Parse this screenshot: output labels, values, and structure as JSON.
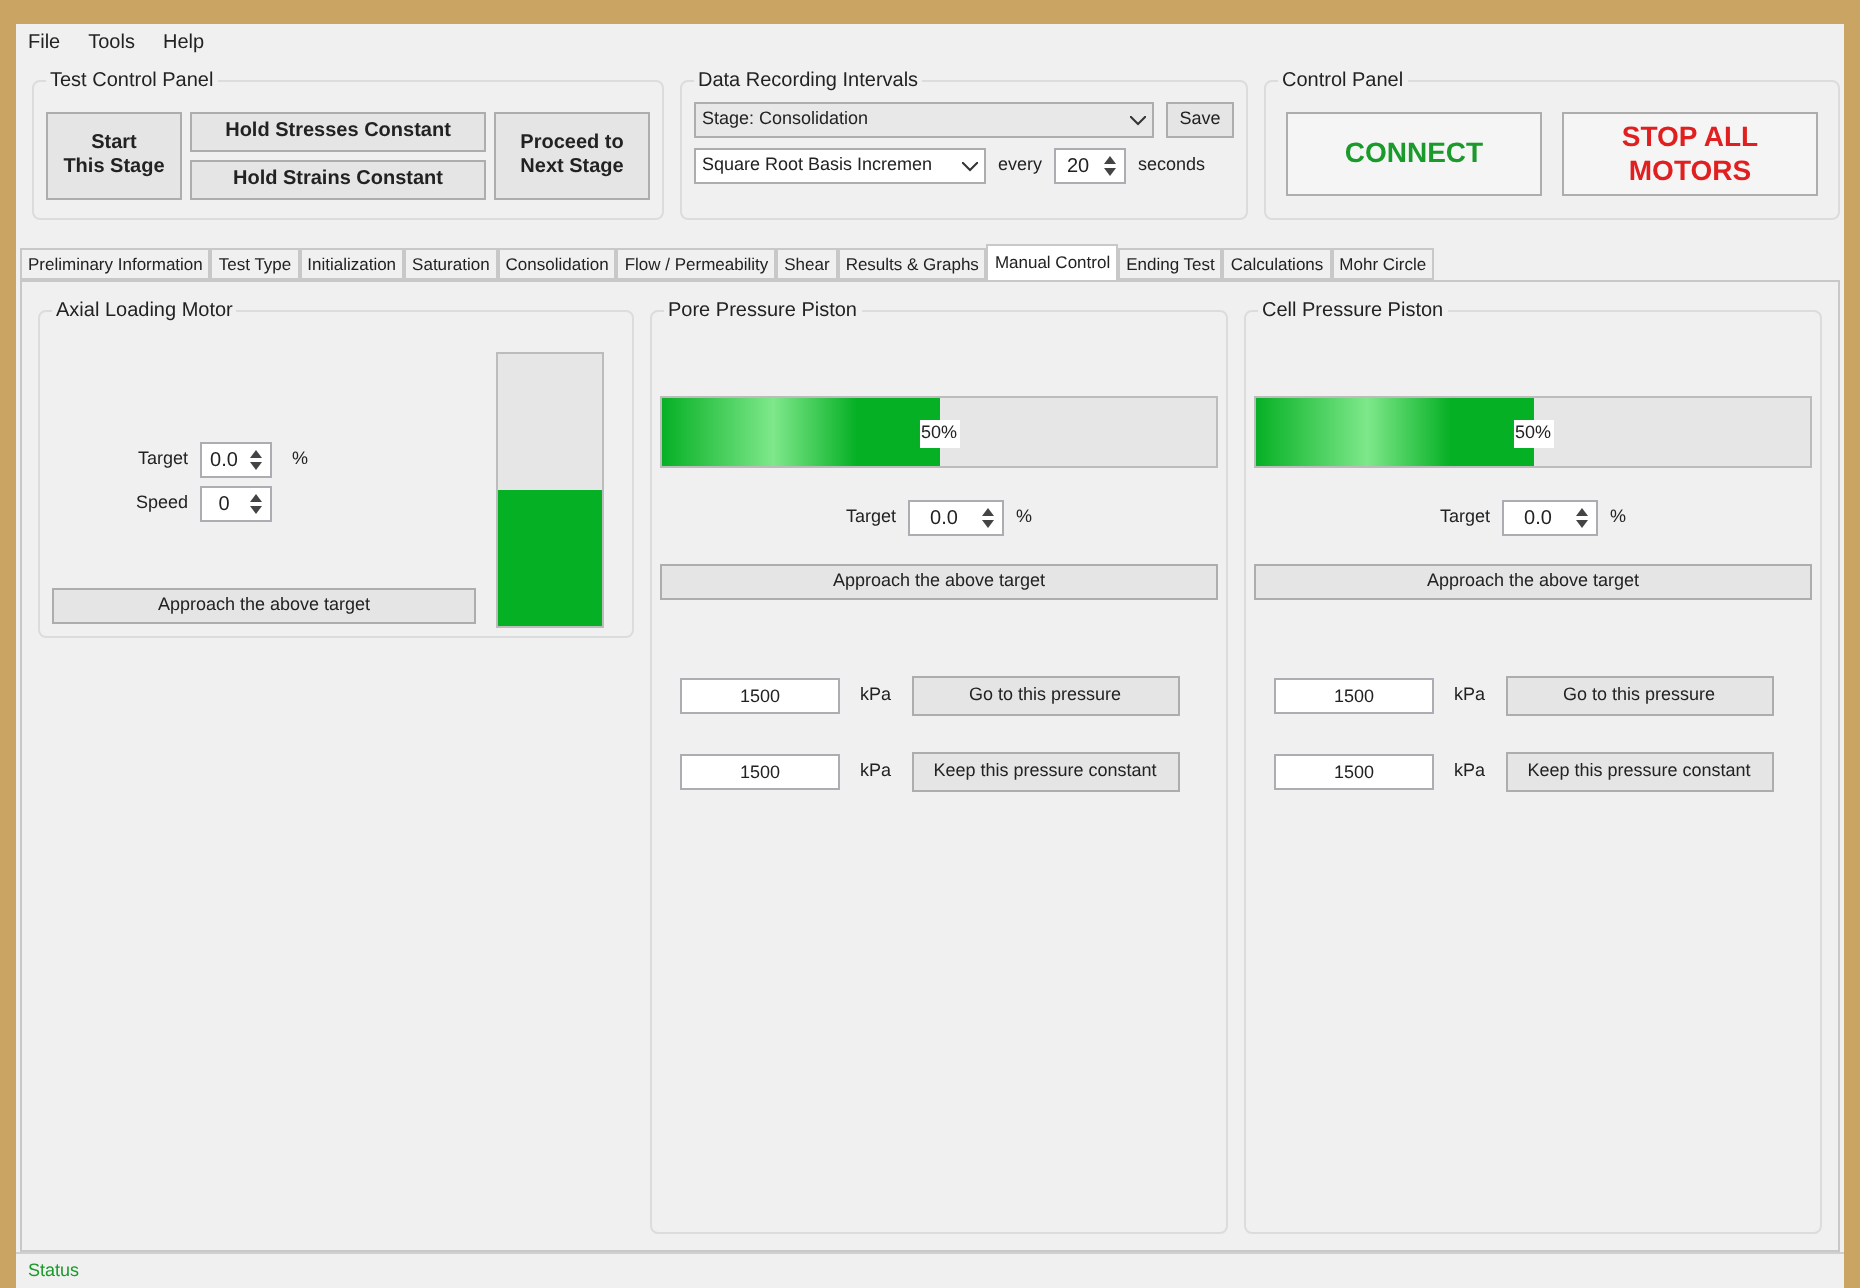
{
  "menu": [
    "File",
    "Tools",
    "Help"
  ],
  "test_control_panel": {
    "title": "Test Control Panel",
    "buttons": [
      "Start\nThis Stage",
      "Hold Stresses Constant",
      "Hold Strains Constant",
      "Proceed to\nNext Stage"
    ]
  },
  "data_recording": {
    "title": "Data Recording Intervals",
    "stage_select": "Stage: Consolidation",
    "save": "Save",
    "method_select": "Square Root Basis Incremen",
    "every": "every",
    "interval": "20",
    "unit": "seconds"
  },
  "control_panel": {
    "title": "Control Panel",
    "connect": "CONNECT",
    "stop": "STOP ALL\nMOTORS"
  },
  "tabs": [
    {
      "label": "Preliminary Information",
      "selected": false
    },
    {
      "label": "Test Type",
      "selected": false
    },
    {
      "label": "Initialization",
      "selected": false
    },
    {
      "label": "Saturation",
      "selected": false
    },
    {
      "label": "Consolidation",
      "selected": false
    },
    {
      "label": "Flow / Permeability",
      "selected": false
    },
    {
      "label": "Shear",
      "selected": false
    },
    {
      "label": "Results & Graphs",
      "selected": false
    },
    {
      "label": "Manual Control",
      "selected": true
    },
    {
      "label": "Ending Test",
      "selected": false
    },
    {
      "label": "Calculations",
      "selected": false
    },
    {
      "label": "Mohr Circle",
      "selected": false
    }
  ],
  "axial": {
    "title": "Axial Loading Motor",
    "target_label": "Target",
    "target": "0.0",
    "target_unit": "%",
    "speed_label": "Speed",
    "speed": "0",
    "approach": "Approach the above target",
    "level": 0.5
  },
  "pistons": [
    {
      "title": "Pore Pressure Piston",
      "level": 0.5,
      "reading": "50%",
      "target_label": "Target",
      "target": "0.0",
      "target_unit": "%",
      "approach": "Approach the above target",
      "pressure1": "1500",
      "unit1": "kPa",
      "go": "Go to this pressure",
      "pressure2": "1500",
      "unit2": "kPa",
      "keep": "Keep this pressure constant"
    },
    {
      "title": "Cell Pressure Piston",
      "level": 0.5,
      "reading": "50%",
      "target_label": "Target",
      "target": "0.0",
      "target_unit": "%",
      "approach": "Approach the above target",
      "pressure1": "1500",
      "unit1": "kPa",
      "go": "Go to this pressure",
      "pressure2": "1500",
      "unit2": "kPa",
      "keep": "Keep this pressure constant"
    }
  ],
  "status_bar": "Status"
}
